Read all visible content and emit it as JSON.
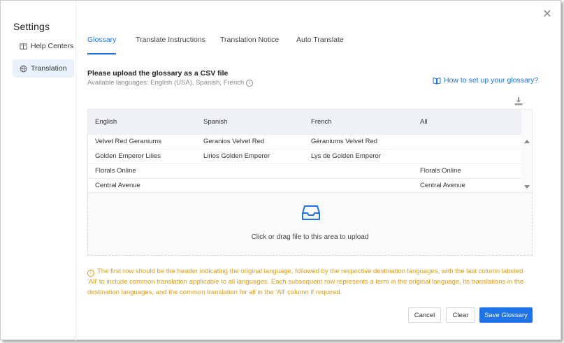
{
  "settings_title": "Settings",
  "sidebar": {
    "items": [
      {
        "label": "Help Centers",
        "icon": "book-icon"
      },
      {
        "label": "Translation",
        "icon": "globe-icon"
      }
    ]
  },
  "tabs": [
    {
      "label": "Glossary"
    },
    {
      "label": "Translate Instructions"
    },
    {
      "label": "Translation Notice"
    },
    {
      "label": "Auto Translate"
    }
  ],
  "glossary": {
    "heading": "Please upload the glossary as a CSV file",
    "available_languages": "Available languages: English (USA), Spanish, French",
    "howto_link": "How to set up your glossary?",
    "columns": [
      "English",
      "Spanish",
      "French",
      "All"
    ],
    "rows": [
      [
        "Velvet Red Geraniums",
        "Geranios Velvet Red",
        "Géraniums Velvet Red",
        ""
      ],
      [
        "Golden Emperor Lilies",
        "Lirios Golden Emperor",
        "Lys de Golden Emperor",
        ""
      ],
      [
        "Florals Online",
        "",
        "",
        "Florals Online"
      ],
      [
        "Central Avenue",
        "",
        "",
        "Central Avenue"
      ]
    ],
    "upload_text": "Click or drag file to this area to upload",
    "note": "The first row should be the header indicating the original language, followed by the respective destination languages, with the last column labeled 'All' to include common translation applicable to all languages. Each subsequent row represents a term in the original language, its translations in the destination languages, and the common translation for all in the 'All' column if required."
  },
  "buttons": {
    "cancel": "Cancel",
    "clear": "Clear",
    "save": "Save Glossary"
  },
  "colors": {
    "accent": "#1e73e8",
    "warning": "#e39c0f",
    "active_bg": "#e8f2fd"
  }
}
